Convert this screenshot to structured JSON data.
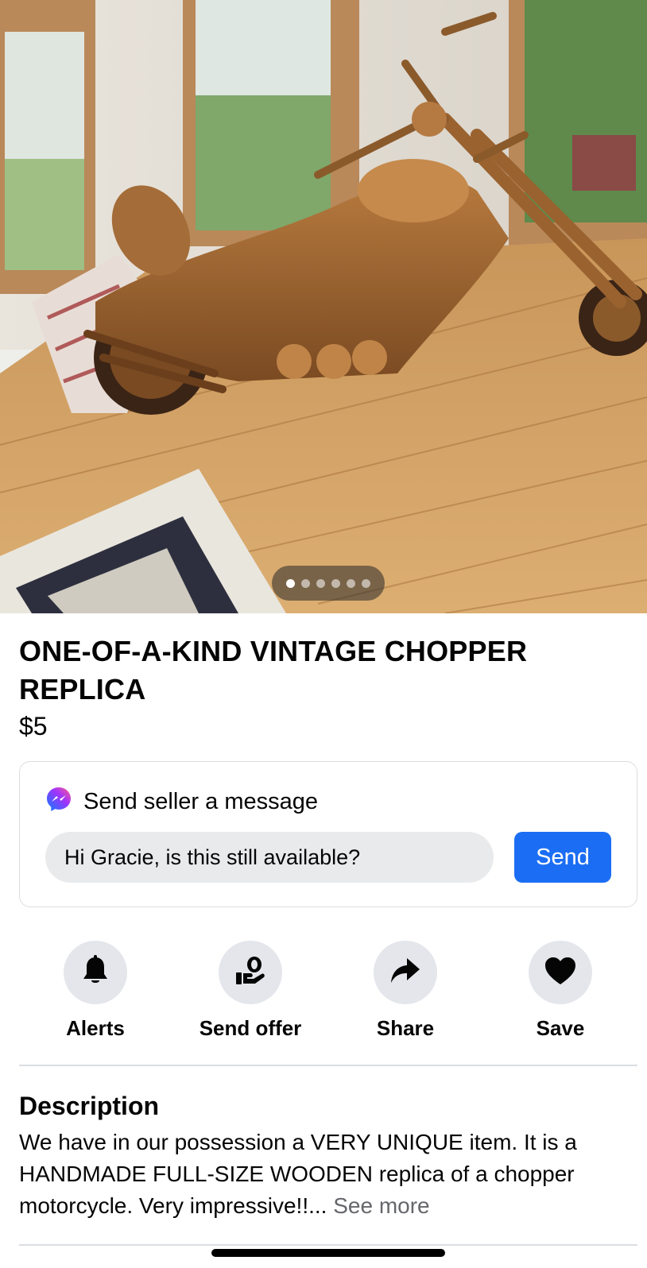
{
  "listing": {
    "title": "ONE-OF-A-KIND VINTAGE CHOPPER REPLICA",
    "price": "$5",
    "photo": {
      "subject": "wooden-chopper-motorcycle-photo",
      "photo_count": 6,
      "active_index": 0
    }
  },
  "message_card": {
    "heading": "Send seller a message",
    "input_value": "Hi Gracie, is this still available?",
    "send_label": "Send",
    "icon": "messenger-icon",
    "colors": {
      "send_button": "#1b6ef3"
    }
  },
  "actions": [
    {
      "label": "Alerts",
      "icon": "bell-icon"
    },
    {
      "label": "Send offer",
      "icon": "offer-hand-icon"
    },
    {
      "label": "Share",
      "icon": "share-arrow-icon"
    },
    {
      "label": "Save",
      "icon": "heart-icon"
    }
  ],
  "description": {
    "heading": "Description",
    "text": "We have in our possession a VERY UNIQUE item. It is a HANDMADE FULL-SIZE WOODEN replica of a chopper motorcycle. Very impressive!!...",
    "see_more": "See more"
  }
}
